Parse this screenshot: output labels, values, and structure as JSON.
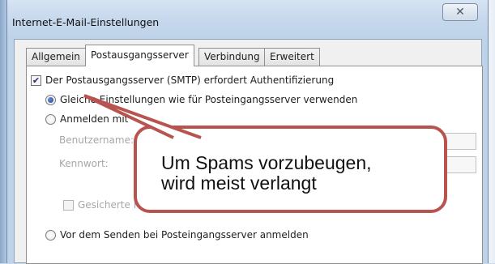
{
  "window": {
    "title": "Internet-E-Mail-Einstellungen",
    "close_symbol": "✕"
  },
  "tabs": [
    {
      "label": "Allgemein",
      "active": false
    },
    {
      "label": "Postausgangsserver",
      "active": true
    },
    {
      "label": "Verbindung",
      "active": false
    },
    {
      "label": "Erweitert",
      "active": false
    }
  ],
  "auth": {
    "checkbox_label": "Der Postausgangsserver (SMTP) erfordert Authentifizierung",
    "checked": true,
    "option_same": "Gleiche Einstellungen wie für Posteingangsserver verwenden",
    "option_same_selected": true,
    "option_login": "Anmelden mit",
    "username_label": "Benutzername:",
    "password_label": "Kennwort:",
    "spa_label": "Gesicherte Kennwortauthentifizierung (SPA) erforderlich",
    "option_pop_before": "Vor dem Senden bei Posteingangsserver anmelden"
  },
  "callout": {
    "line1": "Um Spams vorzubeugen,",
    "line2": "wird meist verlangt",
    "border_color": "#b85450"
  },
  "icons": {
    "check": "check-icon",
    "radio": "radio-selected-icon",
    "close": "close-icon"
  }
}
